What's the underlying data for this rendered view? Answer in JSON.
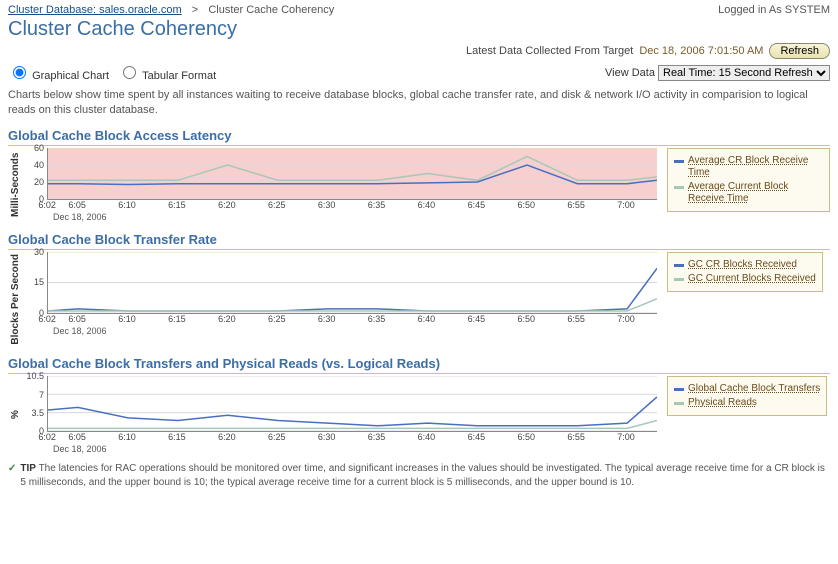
{
  "topbar": {
    "breadcrumb_link": "Cluster Database: sales.oracle.com",
    "breadcrumb_current": "Cluster Cache Coherency",
    "loggedin": "Logged in As SYSTEM"
  },
  "title": "Cluster Cache Coherency",
  "collect": {
    "label": "Latest Data Collected From Target",
    "timestamp": "Dec 18, 2006 7:01:50 AM",
    "refresh_btn": "Refresh"
  },
  "controls": {
    "graphical_label": "Graphical Chart",
    "tabular_label": "Tabular Format",
    "viewdata_label": "View Data",
    "viewdata_option": "Real Time: 15 Second Refresh"
  },
  "description": "Charts below show time spent by all instances waiting to receive database blocks, global cache transfer rate, and disk & network I/O activity in comparision to logical reads on this cluster database.",
  "sections": {
    "s1": "Global Cache Block Access Latency",
    "s2": "Global Cache Block Transfer Rate",
    "s3": "Global Cache Block Transfers and Physical Reads (vs. Logical Reads)"
  },
  "ylabels": {
    "s1": "Milli-Seconds",
    "s2": "Blocks Per Second",
    "s3": "%"
  },
  "xdate": "Dec 18, 2006",
  "legends": {
    "s1": [
      {
        "color": "#4a6fc1",
        "label": "Average CR Block Receive Time"
      },
      {
        "color": "#a7c8b8",
        "label": "Average Current Block Receive Time"
      }
    ],
    "s2": [
      {
        "color": "#4a6fc1",
        "label": "GC CR Blocks Received"
      },
      {
        "color": "#a7c8b8",
        "label": "GC Current Blocks Received"
      }
    ],
    "s3": [
      {
        "color": "#4a6fc1",
        "label": "Global Cache Block Transfers"
      },
      {
        "color": "#a7c8b8",
        "label": "Physical Reads"
      }
    ]
  },
  "tip": {
    "label": "TIP",
    "text": "The latencies for RAC operations should be monitored over time, and significant increases in the values should be investigated. The typical average receive time for a CR block is 5 milliseconds, and the upper bound is 10; the typical average receive time for a current block is 5 milliseconds, and the upper bound is 10."
  },
  "chart_data": [
    {
      "id": "s1",
      "type": "line",
      "title": "Global Cache Block Access Latency",
      "xlabel": "Dec 18, 2006",
      "ylabel": "Milli-Seconds",
      "ylim": [
        0,
        60
      ],
      "yticks": [
        0,
        20,
        40,
        60
      ],
      "xticks": [
        "6:02",
        "6:05",
        "6:10",
        "6:15",
        "6:20",
        "6:25",
        "6:30",
        "6:35",
        "6:40",
        "6:45",
        "6:50",
        "6:55",
        "7:00"
      ],
      "x": [
        6.033,
        6.083,
        6.167,
        6.25,
        6.333,
        6.417,
        6.5,
        6.583,
        6.667,
        6.75,
        6.833,
        6.917,
        7.0,
        7.05
      ],
      "series": [
        {
          "name": "Average CR Block Receive Time",
          "color": "#4a6fc1",
          "values": [
            18,
            18,
            17,
            18,
            18,
            18,
            18,
            18,
            19,
            20,
            40,
            18,
            18,
            22
          ]
        },
        {
          "name": "Average Current Block Receive Time",
          "color": "#a7c8b8",
          "values": [
            22,
            22,
            22,
            22,
            40,
            22,
            22,
            22,
            30,
            22,
            50,
            22,
            22,
            26
          ]
        }
      ]
    },
    {
      "id": "s2",
      "type": "line",
      "title": "Global Cache Block Transfer Rate",
      "xlabel": "Dec 18, 2006",
      "ylabel": "Blocks Per Second",
      "ylim": [
        0,
        30
      ],
      "yticks": [
        0,
        15,
        30
      ],
      "xticks": [
        "6:02",
        "6:05",
        "6:10",
        "6:15",
        "6:20",
        "6:25",
        "6:30",
        "6:35",
        "6:40",
        "6:45",
        "6:50",
        "6:55",
        "7:00"
      ],
      "x": [
        6.033,
        6.083,
        6.167,
        6.25,
        6.333,
        6.417,
        6.5,
        6.583,
        6.667,
        6.75,
        6.833,
        6.917,
        7.0,
        7.05
      ],
      "series": [
        {
          "name": "GC CR Blocks Received",
          "color": "#4a6fc1",
          "values": [
            1,
            2,
            1,
            1,
            1,
            1,
            2,
            2,
            1,
            1,
            1,
            1,
            2,
            22
          ]
        },
        {
          "name": "GC Current Blocks Received",
          "color": "#a7c8b8",
          "values": [
            1,
            1,
            1,
            1,
            1,
            1,
            1,
            1,
            1,
            1,
            1,
            1,
            1,
            7
          ]
        }
      ]
    },
    {
      "id": "s3",
      "type": "line",
      "title": "Global Cache Block Transfers and Physical Reads (vs. Logical Reads)",
      "xlabel": "Dec 18, 2006",
      "ylabel": "%",
      "ylim": [
        0,
        10.5
      ],
      "yticks": [
        0.0,
        3.5,
        7.0,
        10.5
      ],
      "xticks": [
        "6:02",
        "6:05",
        "6:10",
        "6:15",
        "6:20",
        "6:25",
        "6:30",
        "6:35",
        "6:40",
        "6:45",
        "6:50",
        "6:55",
        "7:00"
      ],
      "x": [
        6.033,
        6.083,
        6.167,
        6.25,
        6.333,
        6.417,
        6.5,
        6.583,
        6.667,
        6.75,
        6.833,
        6.917,
        7.0,
        7.05
      ],
      "series": [
        {
          "name": "Global Cache Block Transfers",
          "color": "#4a6fc1",
          "values": [
            4.0,
            4.5,
            2.5,
            2.0,
            3.0,
            2.0,
            1.5,
            1.0,
            1.5,
            1.0,
            1.0,
            1.0,
            1.5,
            6.5
          ]
        },
        {
          "name": "Physical Reads",
          "color": "#a7c8b8",
          "values": [
            0.5,
            0.5,
            0.5,
            0.5,
            0.5,
            0.5,
            0.5,
            0.5,
            0.5,
            0.5,
            0.5,
            0.5,
            0.5,
            2.0
          ]
        }
      ]
    }
  ]
}
